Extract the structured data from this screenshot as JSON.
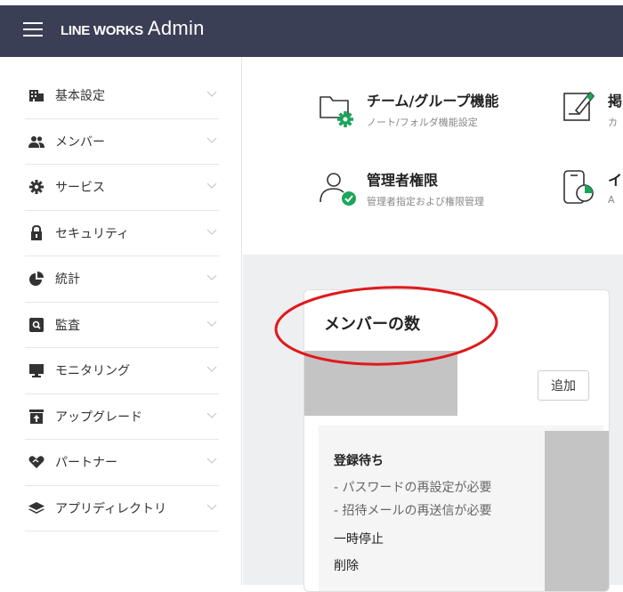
{
  "header": {
    "brand_main": "LINE WORKS",
    "brand_sub": "Admin"
  },
  "sidebar": {
    "items": [
      {
        "label": "基本設定",
        "icon": "building-icon"
      },
      {
        "label": "メンバー",
        "icon": "users-icon"
      },
      {
        "label": "サービス",
        "icon": "gear-icon"
      },
      {
        "label": "セキュリティ",
        "icon": "lock-icon"
      },
      {
        "label": "統計",
        "icon": "pie-chart-icon"
      },
      {
        "label": "監査",
        "icon": "audit-search-icon"
      },
      {
        "label": "モニタリング",
        "icon": "monitor-icon"
      },
      {
        "label": "アップグレード",
        "icon": "upgrade-icon"
      },
      {
        "label": "パートナー",
        "icon": "handshake-icon"
      },
      {
        "label": "アプリディレクトリ",
        "icon": "layers-icon"
      }
    ]
  },
  "shortcuts": {
    "team": {
      "title": "チーム/グループ機能",
      "sub": "ノート/フォルダ機能設定"
    },
    "notice": {
      "title": "掲",
      "sub": "カ"
    },
    "admin": {
      "title": "管理者権限",
      "sub": "管理者指定および権限管理"
    },
    "report": {
      "title": "イ",
      "sub": "A"
    }
  },
  "card": {
    "title": "メンバーの数",
    "add_label": "追加",
    "pending": {
      "title": "登録待ち",
      "line1": "- パスワードの再設定が必要",
      "line2": "- 招待メールの再送信が必要",
      "suspended": "一時停止",
      "deleted": "削除"
    }
  },
  "colors": {
    "header_bg": "#3b3f55",
    "accent_green": "#1aa55a",
    "annotation_red": "#e0191b"
  }
}
